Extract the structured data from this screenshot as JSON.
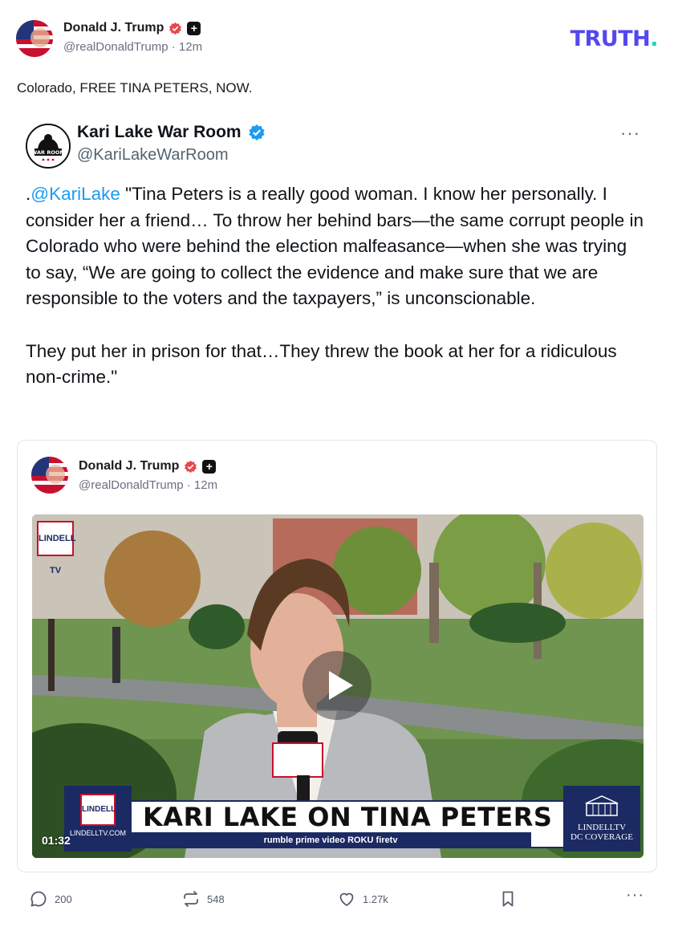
{
  "header": {
    "display_name": "Donald J. Trump",
    "handle": "@realDonaldTrump",
    "time": "12m",
    "logo": "TRUTH",
    "logo_dot": ".",
    "icons": [
      "verified-badge-icon",
      "plus-badge-icon"
    ]
  },
  "post": {
    "text": "Colorado, FREE TINA PETERS, NOW."
  },
  "quoted_tweet": {
    "display_name": "Kari Lake War Room",
    "handle": "@KariLakeWarRoom",
    "avatar_text": "WAR ROOM",
    "more": "···",
    "mention": "@KariLake",
    "body_prefix": ".",
    "body_1": " \"Tina Peters is a really good woman. I know her personally. I consider her a friend… To throw her behind bars—the same corrupt people in Colorado who were behind the election malfeasance—when she was trying to say, “We are going to collect the evidence and make sure that we are responsible to the voters and the taxpayers,” is unconscionable.",
    "body_2": "They put her in prison for that…They threw the book at her for a ridiculous non-crime.\""
  },
  "card": {
    "display_name": "Donald J. Trump",
    "handle": "@realDonaldTrump",
    "time": "12m",
    "video": {
      "duration": "01:32",
      "headline": "KARI LAKE ON TINA PETERS",
      "corner_logo": "LINDELL TV",
      "left_logo": "LINDELL TV",
      "left_url": "LINDELLTV.COM",
      "strip": "rumble   prime video   ROKU   firetv",
      "right_line1": "LINDELLTV",
      "right_line2": "DC COVERAGE"
    }
  },
  "actions": {
    "replies": "200",
    "retruths": "548",
    "likes": "1.27k",
    "more": "···",
    "icons": [
      "reply-icon",
      "retruth-icon",
      "like-icon",
      "bookmark-icon",
      "more-icon"
    ]
  },
  "colors": {
    "truth_brand": "#5448ee",
    "truth_accent": "#1fd3c7",
    "verified_red": "#e5484d",
    "twitter_blue": "#1d9bf0",
    "lindell_navy": "#1b2a63"
  }
}
